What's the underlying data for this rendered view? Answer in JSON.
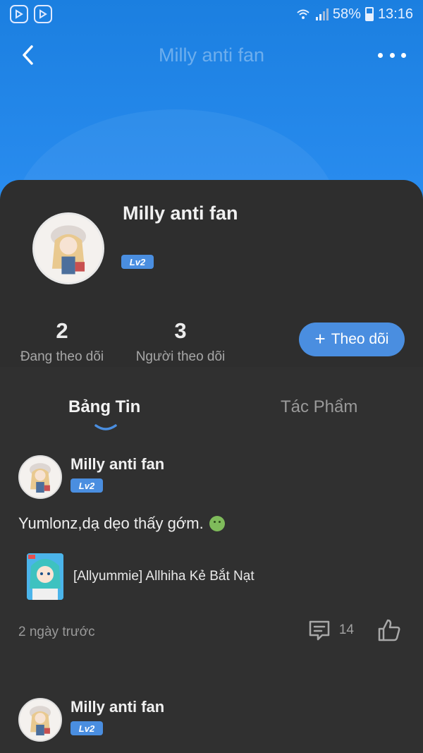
{
  "status_bar": {
    "battery": "58%",
    "battery_level": 0.58,
    "time": "13:16",
    "app_icons": [
      "app-icon",
      "app-icon"
    ]
  },
  "topbar": {
    "title": "Milly anti fan",
    "back_icon": "chevron-left-icon",
    "more_icon": "more-dots-icon"
  },
  "profile": {
    "name": "Milly anti fan",
    "level": "Lv2",
    "following_count": "2",
    "following_label": "Đang theo dõi",
    "followers_count": "3",
    "followers_label": "Người theo dõi",
    "follow_button_label": "Theo dõi",
    "follow_button_icon": "plus-icon"
  },
  "tabs": [
    {
      "label": "Bảng Tin",
      "active": true
    },
    {
      "label": "Tác Phẩm",
      "active": false
    }
  ],
  "posts": [
    {
      "author": "Milly anti fan",
      "level": "Lv2",
      "text": "Yumlonz,dạ dẹo thấy gớm.",
      "text_suffix_glyph": "",
      "emoji": "nauseated-face-icon",
      "link_title": "[Allyummie] Allhiha Kẻ Bắt Nạt",
      "time": "2 ngày trước",
      "comment_count": "14"
    },
    {
      "author": "Milly anti fan",
      "level": "Lv2"
    }
  ],
  "colors": {
    "header_blue": "#1b7fe0",
    "accent": "#4a8ee0",
    "card_bg": "#2e2e2e"
  }
}
